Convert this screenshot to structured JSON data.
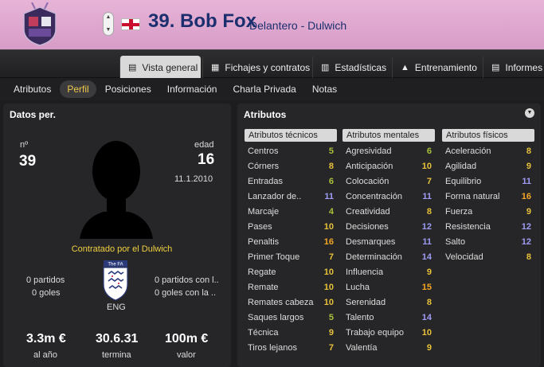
{
  "header": {
    "number_name": "39. Bob Fox",
    "subtitle": "Delantero - Dulwich",
    "nationality_flag": "england-flag",
    "stepper_up": "▲",
    "stepper_down": "▼"
  },
  "tabs": [
    {
      "label": "Vista general",
      "icon": "profile-card-icon"
    },
    {
      "label": "Fichajes y contratos",
      "icon": "document-icon"
    },
    {
      "label": "Estadísticas",
      "icon": "bar-chart-icon"
    },
    {
      "label": "Entrenamiento",
      "icon": "cone-icon"
    },
    {
      "label": "Informes",
      "icon": "report-icon"
    }
  ],
  "subnav": [
    "Atributos",
    "Perfil",
    "Posiciones",
    "Información",
    "Charla Privada",
    "Notas"
  ],
  "personal": {
    "title": "Datos per.",
    "number_label": "nº",
    "number": "39",
    "age_label": "edad",
    "age": "16",
    "birthdate": "11.1.2010",
    "contracted_by": "Contratado por el Dulwich",
    "club_matches": "0 partidos",
    "club_goals": "0 goles",
    "intl_matches": "0 partidos con l..",
    "intl_goals": "0 goles con la ..",
    "nation_code": "ENG",
    "wage": "3.3m €",
    "wage_label": "al año",
    "contract_end": "30.6.31",
    "contract_end_label": "termina",
    "value": "100m €",
    "value_label": "valor"
  },
  "attributes": {
    "title": "Atributos",
    "technical_title": "Atributos técnicos",
    "mental_title": "Atributos mentales",
    "physical_title": "Atributos físicos",
    "technical": [
      {
        "name": "Centros",
        "value": "5"
      },
      {
        "name": "Córners",
        "value": "8"
      },
      {
        "name": "Entradas",
        "value": "6"
      },
      {
        "name": "Lanzador de..",
        "value": "11"
      },
      {
        "name": "Marcaje",
        "value": "4"
      },
      {
        "name": "Pases",
        "value": "10"
      },
      {
        "name": "Penaltis",
        "value": "16"
      },
      {
        "name": "Primer Toque",
        "value": "7"
      },
      {
        "name": "Regate",
        "value": "10"
      },
      {
        "name": "Remate",
        "value": "10"
      },
      {
        "name": "Remates cabeza",
        "value": "10"
      },
      {
        "name": "Saques largos",
        "value": "5"
      },
      {
        "name": "Técnica",
        "value": "9"
      },
      {
        "name": "Tiros lejanos",
        "value": "7"
      }
    ],
    "mental": [
      {
        "name": "Agresividad",
        "value": "6"
      },
      {
        "name": "Anticipación",
        "value": "10"
      },
      {
        "name": "Colocación",
        "value": "7"
      },
      {
        "name": "Concentración",
        "value": "11"
      },
      {
        "name": "Creatividad",
        "value": "8"
      },
      {
        "name": "Decisiones",
        "value": "12"
      },
      {
        "name": "Desmarques",
        "value": "11"
      },
      {
        "name": "Determinación",
        "value": "14"
      },
      {
        "name": "Influencia",
        "value": "9"
      },
      {
        "name": "Lucha",
        "value": "15"
      },
      {
        "name": "Serenidad",
        "value": "8"
      },
      {
        "name": "Talento",
        "value": "14"
      },
      {
        "name": "Trabajo equipo",
        "value": "10"
      },
      {
        "name": "Valentía",
        "value": "9"
      }
    ],
    "physical": [
      {
        "name": "Aceleración",
        "value": "8"
      },
      {
        "name": "Agilidad",
        "value": "9"
      },
      {
        "name": "Equilibrio",
        "value": "11"
      },
      {
        "name": "Forma natural",
        "value": "16"
      },
      {
        "name": "Fuerza",
        "value": "9"
      },
      {
        "name": "Resistencia",
        "value": "12"
      },
      {
        "name": "Salto",
        "value": "12"
      },
      {
        "name": "Velocidad",
        "value": "8"
      }
    ]
  },
  "colors": {
    "low": "#a8c23a",
    "mid": "#e8c23a",
    "high": "#9f9cf5",
    "top": "#f5a623"
  }
}
